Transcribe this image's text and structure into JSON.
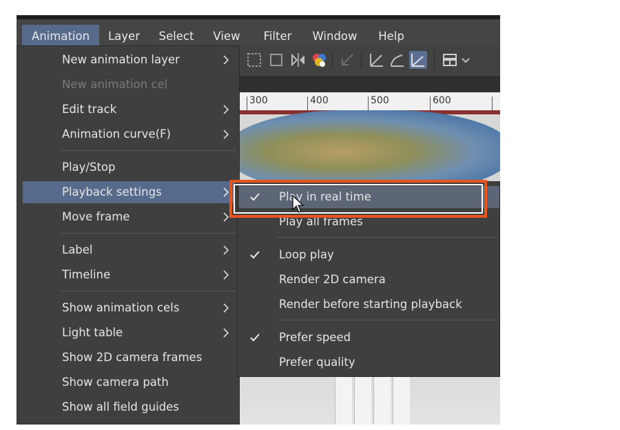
{
  "menubar": {
    "items": [
      {
        "label": "Animation",
        "active": true
      },
      {
        "label": "Layer"
      },
      {
        "label": "Select"
      },
      {
        "label": "View"
      },
      {
        "label": "Filter"
      },
      {
        "label": "Window"
      },
      {
        "label": "Help"
      }
    ]
  },
  "ruler": {
    "labels": [
      "300",
      "400",
      "500",
      "600"
    ]
  },
  "animation_menu": {
    "items": [
      {
        "label": "New animation layer",
        "submenu": true
      },
      {
        "label": "New animation cel",
        "disabled": true
      },
      {
        "label": "Edit track",
        "submenu": true
      },
      {
        "label": "Animation curve(F)",
        "submenu": true
      },
      {
        "label": "Play/Stop"
      },
      {
        "label": "Playback settings",
        "submenu": true,
        "highlighted": true
      },
      {
        "label": "Move frame",
        "submenu": true
      },
      {
        "label": "Label",
        "submenu": true
      },
      {
        "label": "Timeline",
        "submenu": true
      },
      {
        "label": "Show animation cels",
        "submenu": true
      },
      {
        "label": "Light table",
        "submenu": true
      },
      {
        "label": "Show 2D camera frames"
      },
      {
        "label": "Show camera path"
      },
      {
        "label": "Show all field guides"
      }
    ]
  },
  "playback_submenu": {
    "items": [
      {
        "label": "Play in real time",
        "checked": true,
        "highlighted": true
      },
      {
        "label": "Play all frames",
        "checked": false
      },
      {
        "label": "Loop play",
        "checked": true
      },
      {
        "label": "Render 2D camera",
        "checked": false
      },
      {
        "label": "Render before starting playback",
        "checked": false
      },
      {
        "label": "Prefer speed",
        "checked": true
      },
      {
        "label": "Prefer quality",
        "checked": false
      }
    ]
  },
  "colors": {
    "accent_highlight": "#566a8c",
    "callout": "#e8541c",
    "menu_bg": "#3f3f3f"
  }
}
